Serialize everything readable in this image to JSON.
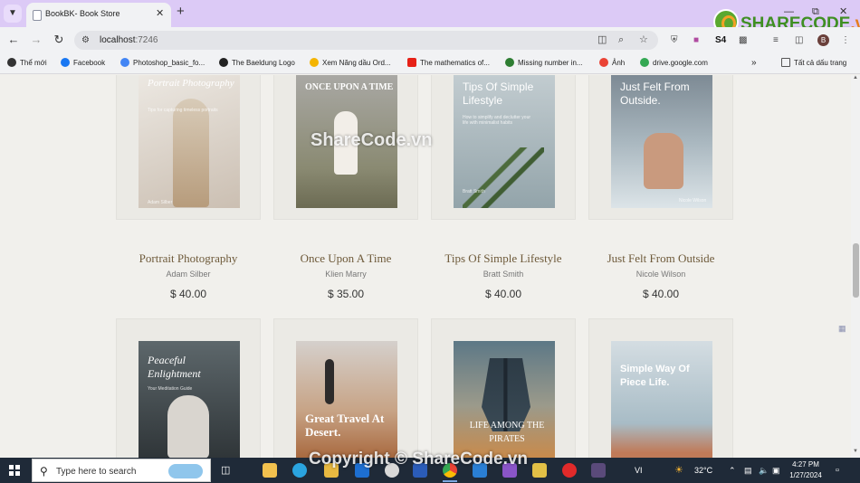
{
  "browser": {
    "tab_title": "BookBK- Book Store",
    "url_host": "localhost",
    "url_port": ":7246",
    "profile_initial": "B",
    "bookmarks": [
      {
        "label": "Thể mới",
        "color": "#333333"
      },
      {
        "label": "Facebook",
        "color": "#1877f2"
      },
      {
        "label": "Photoshop_basic_fo...",
        "color": "#4285f4"
      },
      {
        "label": "The Baeldung Logo",
        "color": "#222222"
      },
      {
        "label": "Xem Năng dầu Ord...",
        "color": "#f4b400"
      },
      {
        "label": "The mathematics of...",
        "color": "#e62117"
      },
      {
        "label": "Missing number in...",
        "color": "#2e7d32"
      },
      {
        "label": "Ảnh",
        "color": "#ea4335"
      },
      {
        "label": "drive.google.com",
        "color": "#34a853"
      }
    ],
    "all_bookmarks_label": "Tất cả dấu trang"
  },
  "watermark": {
    "logo_main": "SHARECODE",
    "logo_domain": ".vn",
    "center": "ShareCode.vn",
    "bottom": "Copyright © ShareCode.vn"
  },
  "books_row1": [
    {
      "name": "Portrait Photography",
      "author": "Adam Silber",
      "price": "$ 40.00",
      "cover_title": "Portrait Photography",
      "cover_sub": "Tips for capturing timeless portraits",
      "cover_bottom": "Adam Silber",
      "cover_colors": [
        "#e7e3dd",
        "#cfc6bb"
      ]
    },
    {
      "name": "Once Upon A Time",
      "author": "Klien Marry",
      "price": "$ 35.00",
      "cover_title": "ONCE UPON A TIME",
      "cover_sub": "",
      "cover_bottom": "",
      "cover_colors": [
        "#a9a7a2",
        "#7b7a63"
      ]
    },
    {
      "name": "Tips Of Simple Lifestyle",
      "author": "Bratt Smith",
      "price": "$ 40.00",
      "cover_title": "Tips Of Simple Lifestyle",
      "cover_sub": "How to simplify and declutter your life with minimalist habits",
      "cover_bottom": "Bratt Smith",
      "cover_colors": [
        "#b7c3c8",
        "#8d9fa6"
      ]
    },
    {
      "name": "Just Felt From Outside",
      "author": "Nicole Wilson",
      "price": "$ 40.00",
      "cover_title": "Just Felt From Outside.",
      "cover_sub": "",
      "cover_bottom": "Nicole Wilson",
      "cover_colors": [
        "#8a96a0",
        "#c9d2d8"
      ]
    }
  ],
  "books_row2": [
    {
      "cover_title": "Peaceful Enlightment",
      "cover_sub": "Your Meditation Guide",
      "cover_colors": [
        "#566064",
        "#2f3538"
      ]
    },
    {
      "cover_title": "Great Travel At Desert.",
      "cover_sub": "",
      "cover_colors": [
        "#c9c4bf",
        "#b2744a"
      ]
    },
    {
      "cover_title": "LIFE AMONG THE PIRATES",
      "cover_sub": "",
      "cover_colors": [
        "#5f7a88",
        "#c98a4a"
      ]
    },
    {
      "cover_title": "Simple Way Of Piece Life.",
      "cover_sub": "",
      "cover_colors": [
        "#c8d3da",
        "#8fa7b3"
      ]
    }
  ],
  "taskbar": {
    "search_placeholder": "Type here to search",
    "weather": "32°C",
    "keyboard": "VI",
    "time": "4:27 PM",
    "date": "1/27/2024"
  }
}
